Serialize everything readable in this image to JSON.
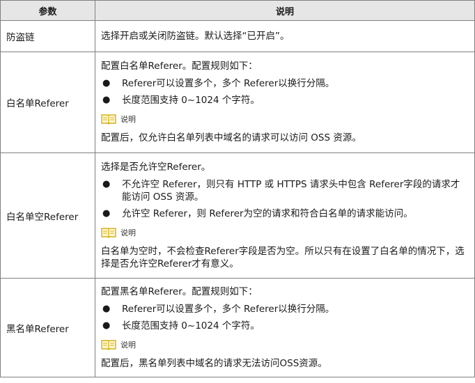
{
  "table": {
    "header": {
      "param": "参数",
      "desc": "说明"
    },
    "rows": [
      {
        "name": "防盗链",
        "intro": "选择开启或关闭防盗链。默认选择“已开启”。"
      },
      {
        "name": "白名单Referer",
        "intro": "配置白名单Referer。配置规则如下：",
        "bullets": [
          "Referer可以设置多个，多个 Referer以换行分隔。",
          "长度范围支持 0~1024 个字符。"
        ],
        "note_label": "说明",
        "note_text": "配置后，仅允许白名单列表中域名的请求可以访问 OSS 资源。"
      },
      {
        "name": "白名单空Referer",
        "intro": "选择是否允许空Referer。",
        "bullets": [
          "不允许空 Referer，则只有 HTTP 或 HTTPS 请求头中包含 Referer字段的请求才能访问 OSS 资源。",
          "允许空 Referer，则 Referer为空的请求和符合白名单的请求能访问。"
        ],
        "note_label": "说明",
        "note_text": "白名单为空时，不会检查Referer字段是否为空。所以只有在设置了白名单的情况下，选择是否允许空Referer才有意义。"
      },
      {
        "name": "黑名单Referer",
        "intro": "配置黑名单Referer。配置规则如下：",
        "bullets": [
          "Referer可以设置多个，多个 Referer以换行分隔。",
          "长度范围支持 0~1024 个字符。"
        ],
        "note_label": "说明",
        "note_text": "配置后，黑名单列表中域名的请求无法访问OSS资源。"
      }
    ],
    "bullet_glyph": "●",
    "note_icon": "book-icon"
  }
}
